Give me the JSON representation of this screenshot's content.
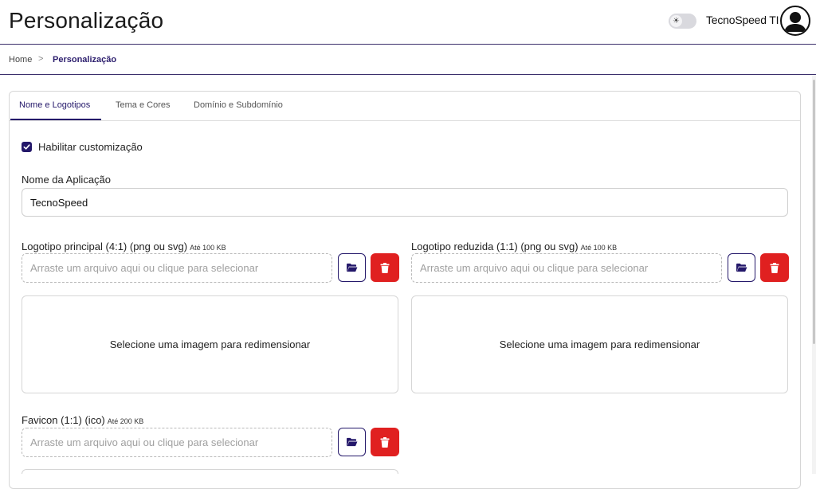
{
  "header": {
    "title": "Personalização",
    "user_name": "TecnoSpeed TI",
    "theme_icon": "☀"
  },
  "breadcrumb": {
    "home": "Home",
    "separator": ">",
    "current": "Personalização"
  },
  "tabs": [
    {
      "label": "Nome e Logotipos",
      "active": true
    },
    {
      "label": "Tema e Cores",
      "active": false
    },
    {
      "label": "Domínio e Subdomínio",
      "active": false
    }
  ],
  "form": {
    "enable_customization": {
      "label": "Habilitar customização",
      "checked": true
    },
    "app_name": {
      "label": "Nome da Aplicação",
      "value": "TecnoSpeed"
    },
    "logo_main": {
      "label": "Logotipo principal (4:1) (png ou svg)",
      "hint": "Até 100 KB",
      "placeholder": "Arraste um arquivo aqui ou clique para selecionar",
      "preview_text": "Selecione uma imagem para redimensionar"
    },
    "logo_reduced": {
      "label": "Logotipo reduzida (1:1) (png ou svg)",
      "hint": "Até 100 KB",
      "placeholder": "Arraste um arquivo aqui ou clique para selecionar",
      "preview_text": "Selecione uma imagem para redimensionar"
    },
    "favicon": {
      "label": "Favicon (1:1) (ico)",
      "hint": "Até 200 KB",
      "placeholder": "Arraste um arquivo aqui ou clique para selecionar"
    }
  },
  "colors": {
    "primary": "#24186a",
    "danger": "#e02020",
    "border": "#d6d6d6"
  }
}
